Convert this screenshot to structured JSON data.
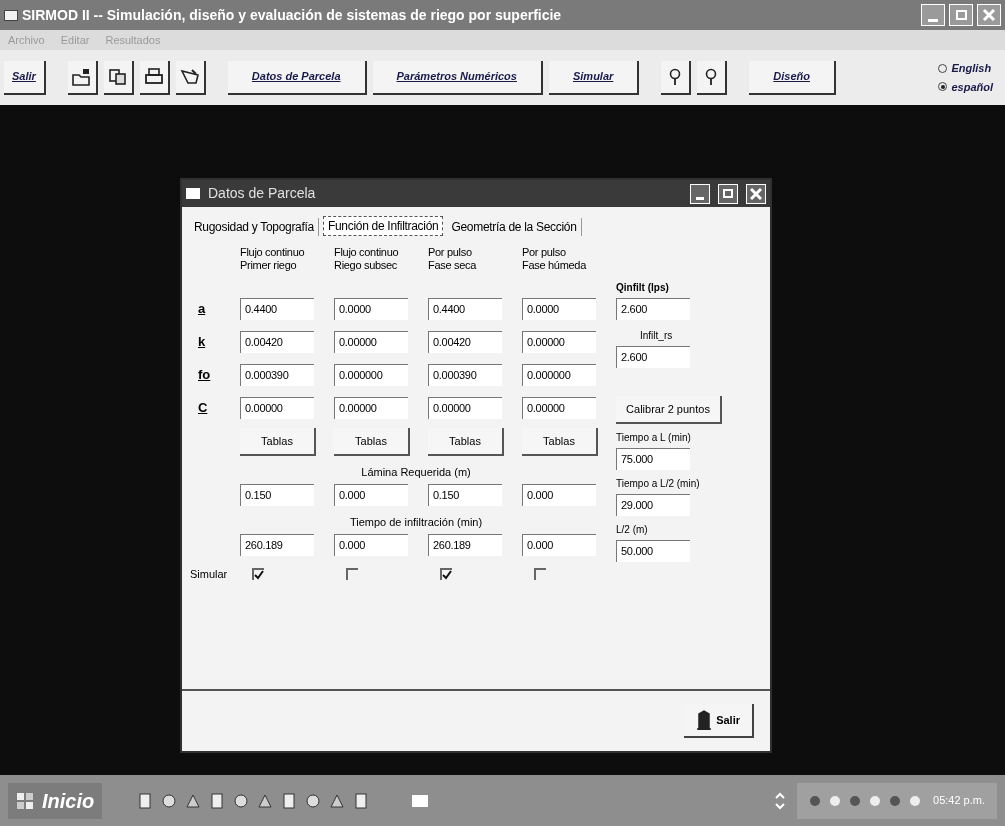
{
  "window": {
    "title": "SIRMOD II -- Simulación, diseño y evaluación de sistemas de riego por superficie"
  },
  "menu": [
    "Archivo",
    "Editar",
    "Resultados"
  ],
  "toolbar": [
    {
      "kind": "text",
      "label": "Salir"
    },
    {
      "kind": "icon"
    },
    {
      "kind": "icon"
    },
    {
      "kind": "icon"
    },
    {
      "kind": "icon"
    },
    {
      "kind": "text",
      "label": "Datos de Parcela"
    },
    {
      "kind": "text",
      "label": "Parámetros Numéricos"
    },
    {
      "kind": "text",
      "label": "Simular"
    },
    {
      "kind": "icon"
    },
    {
      "kind": "icon"
    },
    {
      "kind": "text",
      "label": "Diseño"
    }
  ],
  "languages": [
    {
      "label": "English",
      "selected": false
    },
    {
      "label": "español",
      "selected": true
    }
  ],
  "dialog": {
    "title": "Datos de Parcela",
    "tabs": [
      {
        "label": "Rugosidad y Topografía",
        "selected": false
      },
      {
        "label": "Función de Infiltración",
        "selected": true
      },
      {
        "label": "Geometría de la Sección",
        "selected": false
      }
    ],
    "columns": [
      [
        "Flujo continuo",
        "Primer riego"
      ],
      [
        "Flujo continuo",
        "Riego subsec"
      ],
      [
        "Por pulso",
        "Fase seca"
      ],
      [
        "Por pulso",
        "Fase húmeda"
      ]
    ],
    "params": [
      {
        "label": "a",
        "values": [
          "0.4400",
          "0.0000",
          "0.4400",
          "0.0000"
        ]
      },
      {
        "label": "k",
        "values": [
          "0.00420",
          "0.00000",
          "0.00420",
          "0.00000"
        ]
      },
      {
        "label": "fo",
        "values": [
          "0.000390",
          "0.000000",
          "0.000390",
          "0.000000"
        ]
      },
      {
        "label": "C",
        "values": [
          "0.00000",
          "0.00000",
          "0.00000",
          "0.00000"
        ]
      }
    ],
    "tables_buttons": [
      "Tablas",
      "Tablas",
      "Tablas",
      "Tablas"
    ],
    "lamina": {
      "label": "Lámina Requerida (m)",
      "values": [
        "0.150",
        "0.000",
        "0.150",
        "0.000"
      ]
    },
    "tiempo": {
      "label": "Tiempo de infiltración (min)",
      "values": [
        "260.189",
        "0.000",
        "260.189",
        "0.000"
      ]
    },
    "simular": {
      "label": "Simular",
      "checks": [
        {
          "checked": true
        },
        {
          "checked": false
        },
        {
          "checked": true
        },
        {
          "checked": false
        }
      ]
    },
    "qinfilt": {
      "label": "Qinfilt (lps)",
      "value": "2.600"
    },
    "infilt_rs": {
      "label": "Infilt_rs",
      "value": "2.600"
    },
    "calibrate_button": "Calibrar 2 puntos",
    "right_fields": [
      {
        "label": "Tiempo a L (min)",
        "value": "75.000"
      },
      {
        "label": "Tiempo a L/2 (min)",
        "value": "29.000"
      },
      {
        "label": "L/2 (m)",
        "value": "50.000"
      }
    ],
    "exit_button": "Salir"
  },
  "taskbar": {
    "start": "Inicio",
    "clock": "05:42 p.m."
  }
}
